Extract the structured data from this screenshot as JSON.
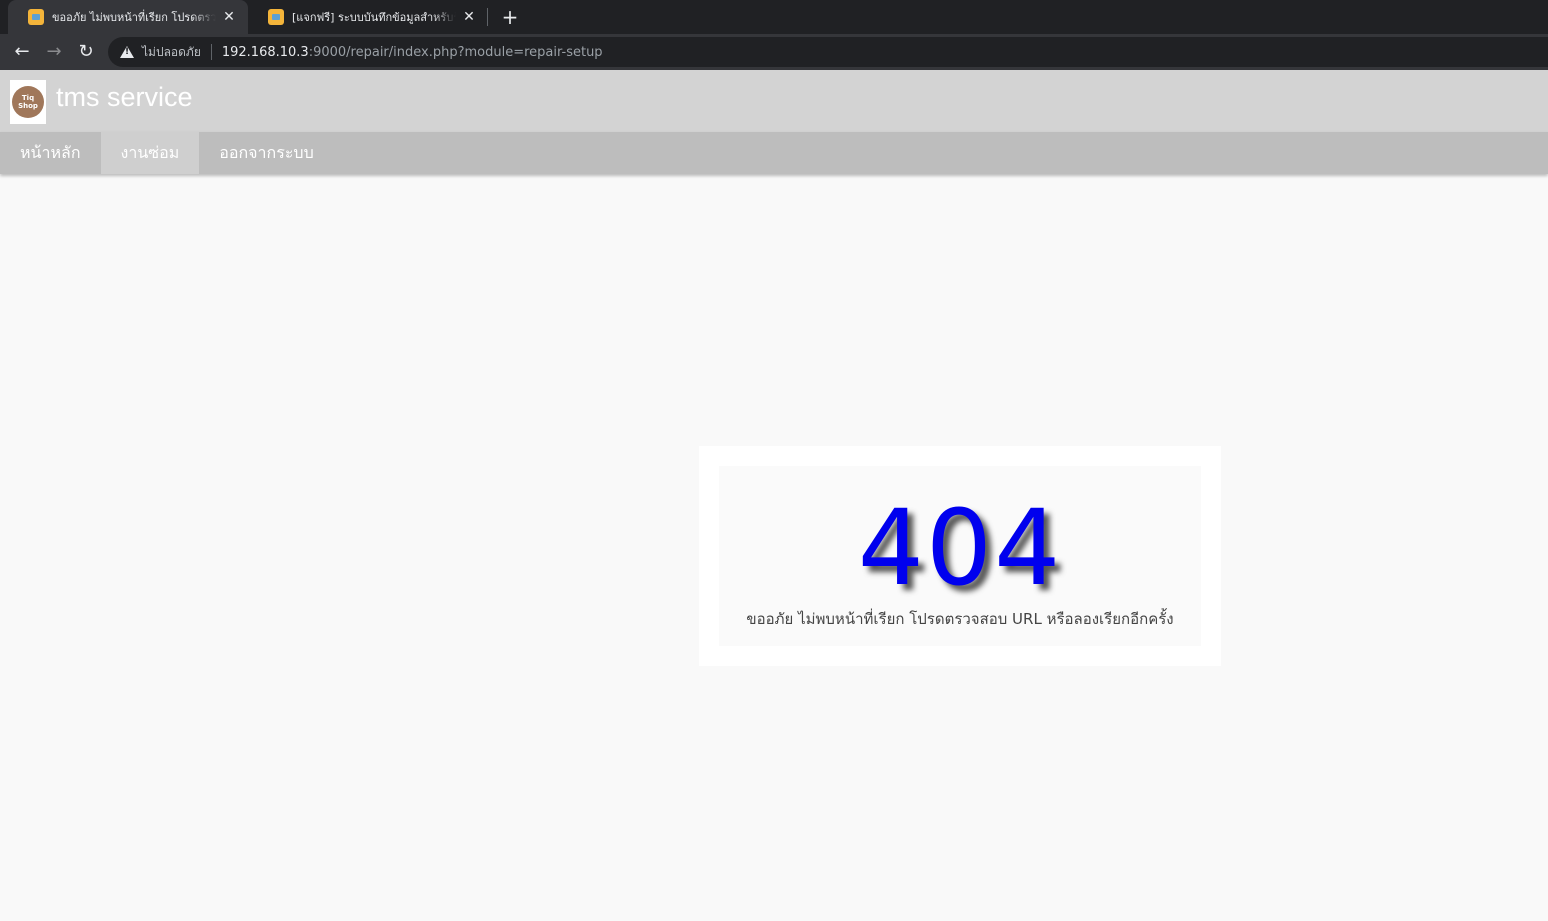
{
  "browser": {
    "tabs": [
      {
        "title": "ขออภัย ไม่พบหน้าที่เรียก โปรดตรวจสอบ URL",
        "active": true
      },
      {
        "title": "[แจกฟรี] ระบบบันทึกข้อมูลสำหรับร้านซ่อม",
        "active": false
      }
    ],
    "close_glyph": "✕",
    "new_tab_glyph": "+",
    "security_label": "ไม่ปลอดภัย",
    "url_host": "192.168.10.3",
    "url_rest": ":9000/repair/index.php?module=repair-setup"
  },
  "app": {
    "title": "tms service",
    "logo_text_top": "Tiq",
    "logo_text_bottom": "Shop",
    "menu": [
      {
        "label": "หน้าหลัก",
        "active": false
      },
      {
        "label": "งานซ่อม",
        "active": true
      },
      {
        "label": "ออกจากระบบ",
        "active": false
      }
    ]
  },
  "error": {
    "code": "404",
    "message": "ขออภัย ไม่พบหน้าที่เรียก โปรดตรวจสอบ URL หรือลองเรียกอีกครั้ง"
  },
  "colors": {
    "error_code": "#0000ee",
    "header_bg": "#d3d3d3",
    "menu_bg": "#bdbdbd"
  }
}
